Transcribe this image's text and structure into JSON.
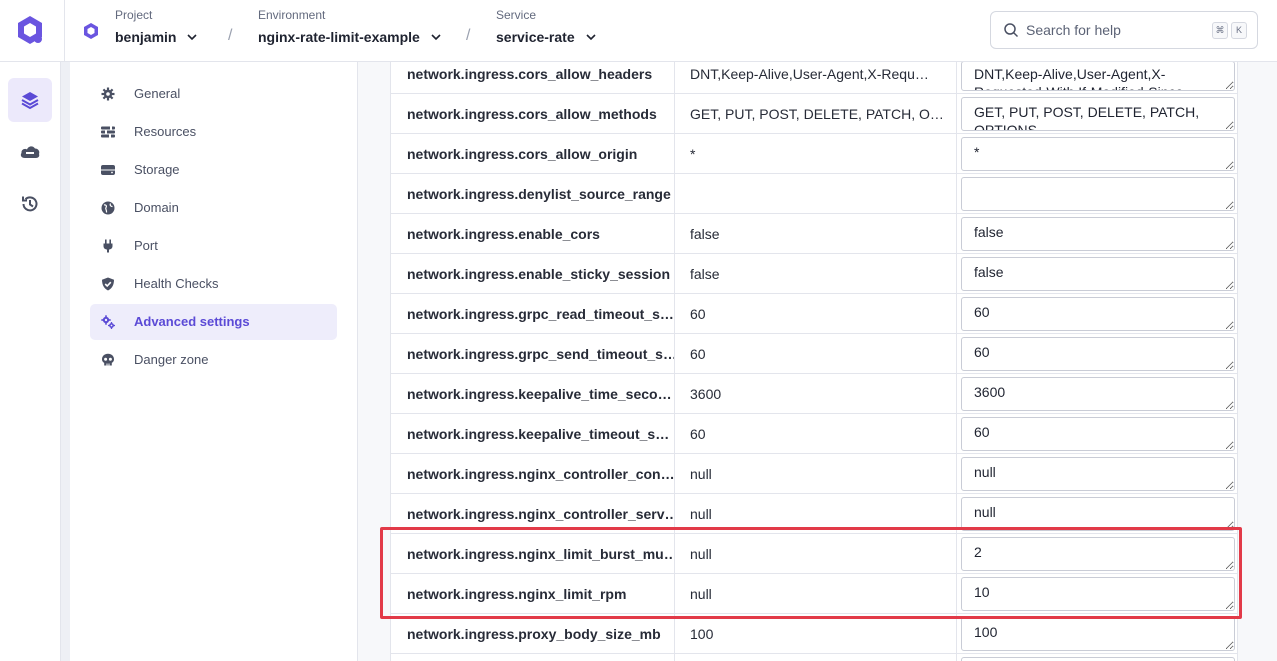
{
  "header": {
    "breadcrumbs": [
      {
        "label": "Project",
        "value": "benjamin"
      },
      {
        "label": "Environment",
        "value": "nginx-rate-limit-example"
      },
      {
        "label": "Service",
        "value": "service-rate"
      }
    ],
    "separator": "/",
    "search": {
      "placeholder": "Search for help",
      "shortcut_keys": [
        "⌘",
        "K"
      ]
    }
  },
  "rail": {
    "items": [
      {
        "icon": "layers-icon",
        "active": true
      },
      {
        "icon": "cloud-icon",
        "active": false
      },
      {
        "icon": "history-icon",
        "active": false
      }
    ]
  },
  "settings_nav": {
    "items": [
      {
        "label": "General",
        "icon": "gear-icon"
      },
      {
        "label": "Resources",
        "icon": "sliders-icon"
      },
      {
        "label": "Storage",
        "icon": "hard-drive-icon"
      },
      {
        "label": "Domain",
        "icon": "globe-icon"
      },
      {
        "label": "Port",
        "icon": "plug-icon"
      },
      {
        "label": "Health Checks",
        "icon": "shield-check-icon"
      },
      {
        "label": "Advanced settings",
        "icon": "gears-icon",
        "active": true
      },
      {
        "label": "Danger zone",
        "icon": "skull-icon"
      }
    ]
  },
  "settings_table": {
    "rows": [
      {
        "key": "network.ingress.cors_allow_headers",
        "default": "DNT,Keep-Alive,User-Agent,X-Requ…",
        "value": "DNT,Keep-Alive,User-Agent,X-Requested-With,If-Modified-Since"
      },
      {
        "key": "network.ingress.cors_allow_methods",
        "default": "GET, PUT, POST, DELETE, PATCH, O…",
        "value": "GET, PUT, POST, DELETE, PATCH, OPTIONS"
      },
      {
        "key": "network.ingress.cors_allow_origin",
        "default": "*",
        "value": "*"
      },
      {
        "key": "network.ingress.denylist_source_range",
        "default": "",
        "value": ""
      },
      {
        "key": "network.ingress.enable_cors",
        "default": "false",
        "value": "false"
      },
      {
        "key": "network.ingress.enable_sticky_session",
        "default": "false",
        "value": "false"
      },
      {
        "key": "network.ingress.grpc_read_timeout_s…",
        "default": "60",
        "value": "60"
      },
      {
        "key": "network.ingress.grpc_send_timeout_s…",
        "default": "60",
        "value": "60"
      },
      {
        "key": "network.ingress.keepalive_time_seco…",
        "default": "3600",
        "value": "3600"
      },
      {
        "key": "network.ingress.keepalive_timeout_s…",
        "default": "60",
        "value": "60"
      },
      {
        "key": "network.ingress.nginx_controller_con…",
        "default": "null",
        "value": "null"
      },
      {
        "key": "network.ingress.nginx_controller_serv…",
        "default": "null",
        "value": "null"
      },
      {
        "key": "network.ingress.nginx_limit_burst_mu…",
        "default": "null",
        "value": "2"
      },
      {
        "key": "network.ingress.nginx_limit_rpm",
        "default": "null",
        "value": "10"
      },
      {
        "key": "network.ingress.proxy_body_size_mb",
        "default": "100",
        "value": "100"
      },
      {
        "key": "",
        "default": "",
        "value": ""
      }
    ]
  },
  "colors": {
    "accent": "#5b4ad6",
    "highlight": "#e23a48"
  }
}
